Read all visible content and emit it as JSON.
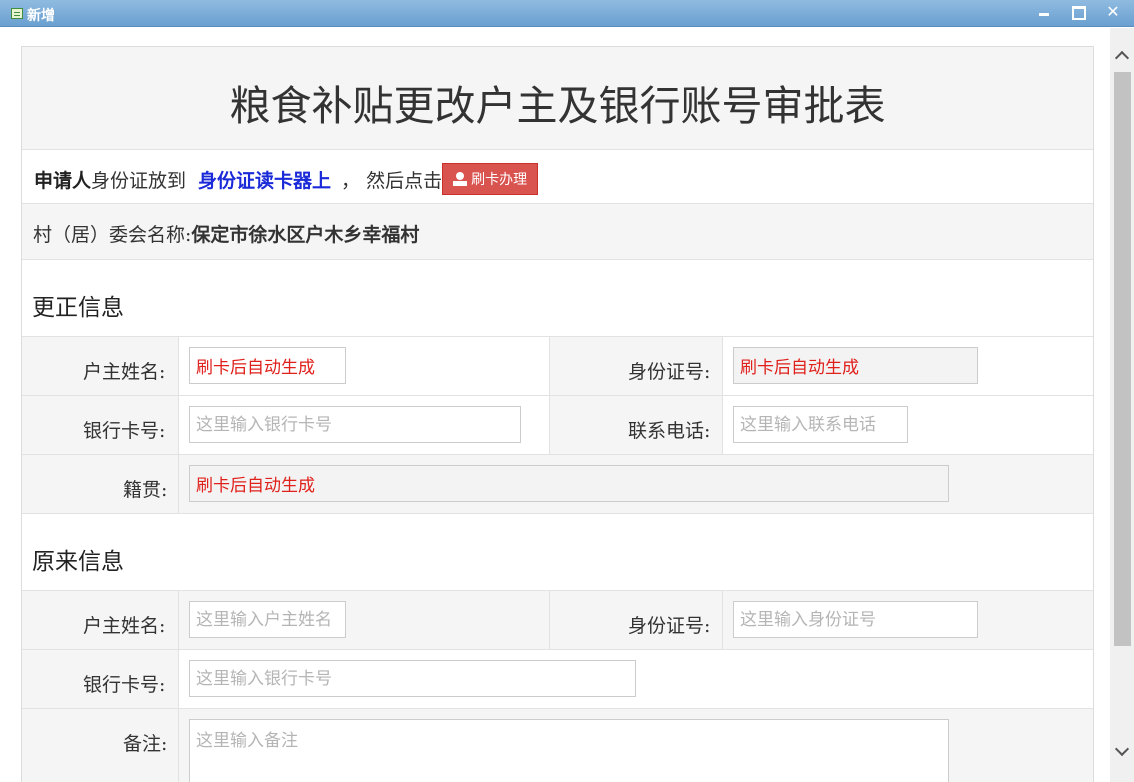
{
  "window": {
    "title": "新增"
  },
  "form": {
    "title": "粮食补贴更改户主及银行账号审批表",
    "applicant": {
      "label": "申请人",
      "text1": "身份证放到",
      "reader": "身份证读卡器上",
      "comma": "，",
      "text2": "然后点击",
      "button": "刷卡办理"
    },
    "village": {
      "label": "村（居）委会名称:",
      "value": "保定市徐水区户木乡幸福村"
    },
    "corrected": {
      "section_title": "更正信息",
      "owner_name_label": "户主姓名:",
      "owner_name_value": "刷卡后自动生成",
      "id_label": "身份证号:",
      "id_value": "刷卡后自动生成",
      "bank_label": "银行卡号:",
      "bank_placeholder": "这里输入银行卡号",
      "phone_label": "联系电话:",
      "phone_placeholder": "这里输入联系电话",
      "origin_label": "籍贯:",
      "origin_value": "刷卡后自动生成"
    },
    "original": {
      "section_title": "原来信息",
      "owner_name_label": "户主姓名:",
      "owner_name_placeholder": "这里输入户主姓名",
      "id_label": "身份证号:",
      "id_placeholder": "这里输入身份证号",
      "bank_label": "银行卡号:",
      "bank_placeholder": "这里输入银行卡号",
      "remark_label": "备注:",
      "remark_placeholder": "这里输入备注"
    }
  },
  "colors": {
    "titlebar": "#7aaed8",
    "button": "#d9534f",
    "reader_text": "#1a2ad8",
    "auto_text": "#e0201b"
  }
}
